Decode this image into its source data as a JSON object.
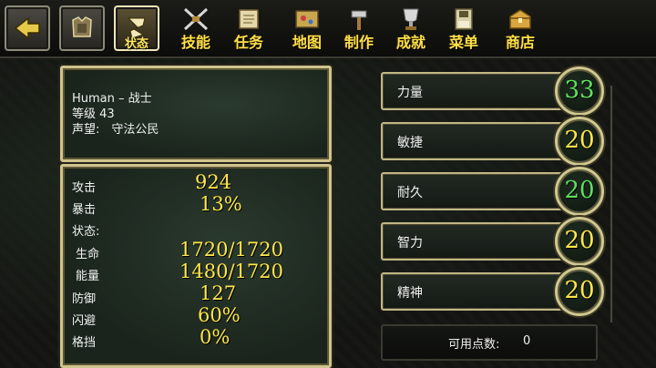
{
  "nav": {
    "status_label": "状态",
    "tabs": [
      "技能",
      "任务",
      "地图",
      "制作",
      "成就",
      "菜单",
      "商店"
    ]
  },
  "info": {
    "race_class": "Human – 战士",
    "level": "等级 43",
    "reputation": "声望:　守法公民"
  },
  "stats": [
    {
      "label": "攻击",
      "value": "924"
    },
    {
      "label": "暴击",
      "value": "13%"
    },
    {
      "label": "状态:",
      "value": ""
    },
    {
      "label": "生命",
      "value": "1720/1720"
    },
    {
      "label": "能量",
      "value": "1480/1720"
    },
    {
      "label": "防御",
      "value": "127"
    },
    {
      "label": "闪避",
      "value": "60%"
    },
    {
      "label": "格挡",
      "value": "0%"
    }
  ],
  "attributes": [
    {
      "label": "力量",
      "value": "33"
    },
    {
      "label": "敏捷",
      "value": "20"
    },
    {
      "label": "耐久",
      "value": "20"
    },
    {
      "label": "智力",
      "value": "20"
    },
    {
      "label": "精神",
      "value": "20"
    }
  ],
  "points": {
    "label": "可用点数:",
    "value": "0"
  },
  "colors": {
    "accent_yellow": "#ffe84a",
    "accent_green": "#5fe05f",
    "frame_gold": "#cfc48c"
  }
}
